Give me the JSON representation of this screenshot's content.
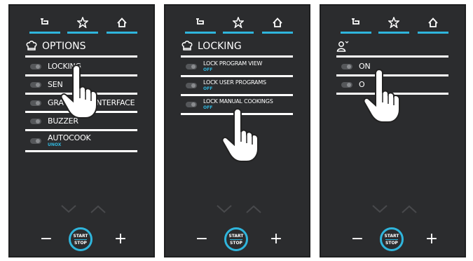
{
  "topbar": {
    "icons": [
      "back-icon",
      "favorite-star-icon",
      "home-icon"
    ],
    "accent": "#2fb5dc"
  },
  "panels": [
    {
      "title": "OPTIONS",
      "title_icon": "chef-hat-icon",
      "items": [
        {
          "label": "LOCKING",
          "sub": ""
        },
        {
          "label": "SEN",
          "sub": ""
        },
        {
          "label": "GRA",
          "label2": "ER INTERFACE",
          "sub": ""
        },
        {
          "label": "BUZZER",
          "sub": ""
        },
        {
          "label": "AUTOCOOK",
          "sub": "UNOX"
        }
      ]
    },
    {
      "title": "LOCKING",
      "title_icon": "chef-hat-icon",
      "items": [
        {
          "label": "LOCK PROGRAM VIEW",
          "sub": "OFF"
        },
        {
          "label": "LOCK USER PROGRAMS",
          "sub": "OFF"
        },
        {
          "label": "LOCK MANUAL COOKINGS",
          "sub": "OFF"
        }
      ]
    },
    {
      "title": "",
      "title_icon": "user-lock-icon",
      "items": [
        {
          "label": "ON",
          "sub": ""
        },
        {
          "label": "O",
          "sub": ""
        }
      ]
    }
  ],
  "bottom": {
    "minus": "−",
    "plus": "+",
    "start": "START",
    "stop": "STOP"
  }
}
